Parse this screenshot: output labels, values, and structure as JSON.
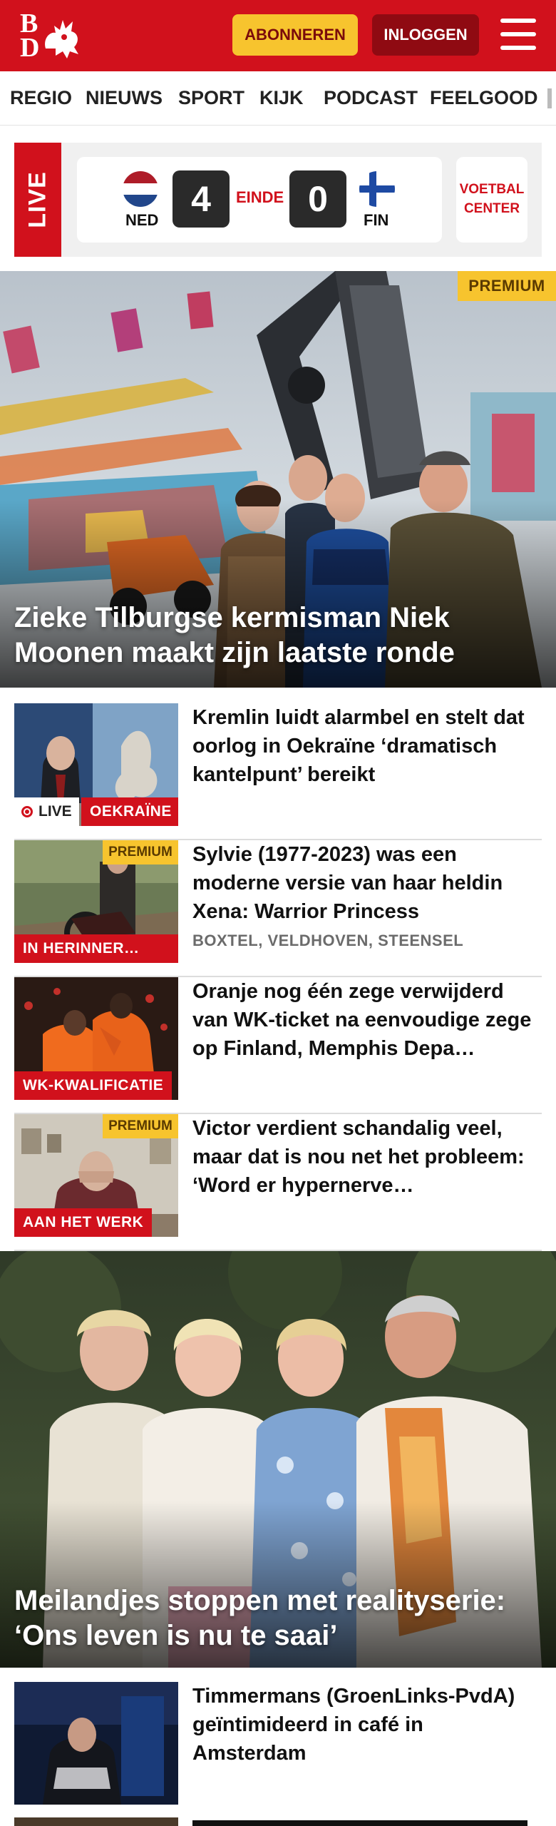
{
  "header": {
    "logo_text_top": "B",
    "logo_text_bottom": "D",
    "subscribe_label": "ABONNEREN",
    "login_label": "INLOGGEN",
    "menu_icon": "hamburger-icon"
  },
  "nav": {
    "items": [
      "REGIO",
      "NIEUWS",
      "SPORT",
      "KIJK",
      "PODCAST",
      "FEELGOOD"
    ]
  },
  "live": {
    "label": "LIVE",
    "home_team": "NED",
    "home_score": "4",
    "status": "EINDE",
    "away_score": "0",
    "away_team": "FIN",
    "center_label": "VOETBAL CENTER"
  },
  "hero1": {
    "premium": "PREMIUM",
    "title": "Zieke Tilburgse kermisman Niek Moonen maakt zijn laatste ronde"
  },
  "articles": [
    {
      "title": "Kremlin luidt alarmbel en stelt dat oorlog in Oekraïne ‘dramatisch kantelpunt’ bereikt",
      "live_label": "LIVE",
      "tag": "OEKRAÏNE"
    },
    {
      "premium": "PREMIUM",
      "title": "Sylvie (1977-2023) was een moderne versie van haar heldin Xena: Warrior Princess",
      "meta": "BOXTEL, VELDHOVEN, STEENSEL",
      "tag": "IN HERINNER…"
    },
    {
      "title": "Oranje nog één zege verwijderd van WK-ticket na eenvoudige zege op Finland, Memphis Depa…",
      "tag": "WK-KWALIFICATIE"
    },
    {
      "premium": "PREMIUM",
      "title": "Victor verdient schandalig veel, maar dat is nou net het probleem: ‘Word er hypernerve…",
      "tag": "AAN HET WERK"
    }
  ],
  "hero2": {
    "title": "Meilandjes stoppen met realityserie: ‘Ons leven is nu te saai’"
  },
  "articles2": [
    {
      "title": "Timmermans (GroenLinks-PvdA) geïntimideerd in café in Amsterdam"
    }
  ],
  "colors": {
    "brand_red": "#d1111c",
    "premium_yellow": "#f7c42e",
    "login_dark_red": "#8f0a12"
  }
}
